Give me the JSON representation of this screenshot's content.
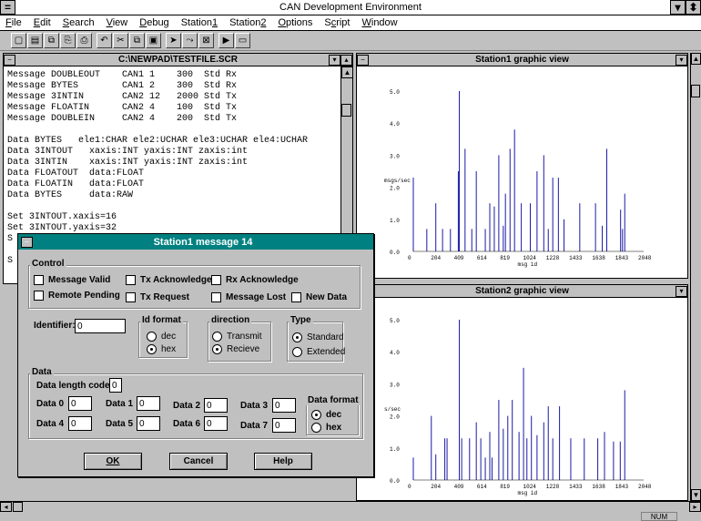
{
  "app": {
    "title": "CAN Development Environment"
  },
  "menu": [
    {
      "pre": "",
      "u": "F",
      "post": "ile"
    },
    {
      "pre": "",
      "u": "E",
      "post": "dit"
    },
    {
      "pre": "",
      "u": "S",
      "post": "earch"
    },
    {
      "pre": "",
      "u": "V",
      "post": "iew"
    },
    {
      "pre": "",
      "u": "D",
      "post": "ebug"
    },
    {
      "pre": "Station",
      "u": "1",
      "post": ""
    },
    {
      "pre": "Station",
      "u": "2",
      "post": ""
    },
    {
      "pre": "",
      "u": "O",
      "post": "ptions"
    },
    {
      "pre": "S",
      "u": "c",
      "post": "ript"
    },
    {
      "pre": "",
      "u": "W",
      "post": "indow"
    }
  ],
  "toolbar_icons": [
    "new-file-icon",
    "open-file-icon",
    "copy-icon",
    "paste-icon",
    "print-icon",
    "undo-icon",
    "cut-icon",
    "copy2-icon",
    "clipboard-icon",
    "cursor-icon",
    "step-icon",
    "stop-icon",
    "run-icon",
    "window-icon"
  ],
  "editor": {
    "title": "C:\\NEWPAD\\TESTFILE.SCR",
    "lines": [
      "Message DOUBLEOUT    CAN1 1    300  Std Rx",
      "Message BYTES        CAN1 2    300  Std Rx",
      "Message 3INTIN       CAN2 12   2000 Std Tx",
      "Message FLOATIN      CAN2 4    100  Std Tx",
      "Message DOUBLEIN     CAN2 4    200  Std Tx",
      "",
      "Data BYTES   ele1:CHAR ele2:UCHAR ele3:UCHAR ele4:UCHAR",
      "Data 3INTOUT   xaxis:INT yaxis:INT zaxis:int",
      "Data 3INTIN    xaxis:INT yaxis:INT zaxis:int",
      "Data FLOATOUT  data:FLOAT",
      "Data FLOATIN   data:FLOAT",
      "Data BYTES     data:RAW",
      "",
      "Set 3INTOUT.xaxis=16",
      "Set 3INTOUT.yaxis=32",
      "S",
      "",
      "S"
    ]
  },
  "graph1": {
    "title": "Station1 graphic view",
    "ylabel": "msgs/sec",
    "xlabel": "msg id",
    "yticks": [
      "5.0",
      "4.0",
      "3.0",
      "2.0",
      "1.0",
      "0.0"
    ],
    "xticks": [
      "0",
      "204",
      "409",
      "614",
      "819",
      "1024",
      "1228",
      "1433",
      "1638",
      "1843",
      "2048"
    ]
  },
  "graph2": {
    "title": "Station2 graphic view",
    "ylabel": "s/sec",
    "xlabel": "msg id",
    "yticks": [
      "5.0",
      "4.0",
      "3.0",
      "2.0",
      "1.0",
      "0.0"
    ],
    "xticks": [
      "0",
      "204",
      "409",
      "614",
      "819",
      "1024",
      "1228",
      "1433",
      "1638",
      "1843",
      "2048"
    ]
  },
  "dialog": {
    "title": "Station1 message 14",
    "control_label": "Control",
    "checks": {
      "valid": "Message Valid",
      "txack": "Tx Acknowledge",
      "rxack": "Rx Acknowledge",
      "remote": "Remote Pending",
      "txreq": "Tx Request",
      "lost": "Message Lost",
      "newdata": "New Data"
    },
    "identifier_label": "Identifier:",
    "identifier_value": "0",
    "idformat": {
      "label": "Id format",
      "opt1": "dec",
      "opt2": "hex"
    },
    "direction": {
      "label": "direction",
      "opt1": "Transmit",
      "opt2": "Recieve"
    },
    "type": {
      "label": "Type",
      "opt1": "Standard",
      "opt2": "Extended"
    },
    "data_label": "Data",
    "dlc_label": "Data length code",
    "dlc_value": "0",
    "d": [
      {
        "label": "Data 0",
        "value": "0"
      },
      {
        "label": "Data 1",
        "value": "0"
      },
      {
        "label": "Data 2",
        "value": "0"
      },
      {
        "label": "Data 3",
        "value": "0"
      },
      {
        "label": "Data 4",
        "value": "0"
      },
      {
        "label": "Data 5",
        "value": "0"
      },
      {
        "label": "Data 6",
        "value": "0"
      },
      {
        "label": "Data 7",
        "value": "0"
      }
    ],
    "dataformat": {
      "label": "Data format",
      "opt1": "dec",
      "opt2": "hex"
    },
    "ok": "OK",
    "cancel": "Cancel",
    "help": "Help"
  },
  "status": {
    "num": "NUM"
  },
  "colors": {
    "bar": "#1a1aa8",
    "dialog_title": "#008080"
  }
}
